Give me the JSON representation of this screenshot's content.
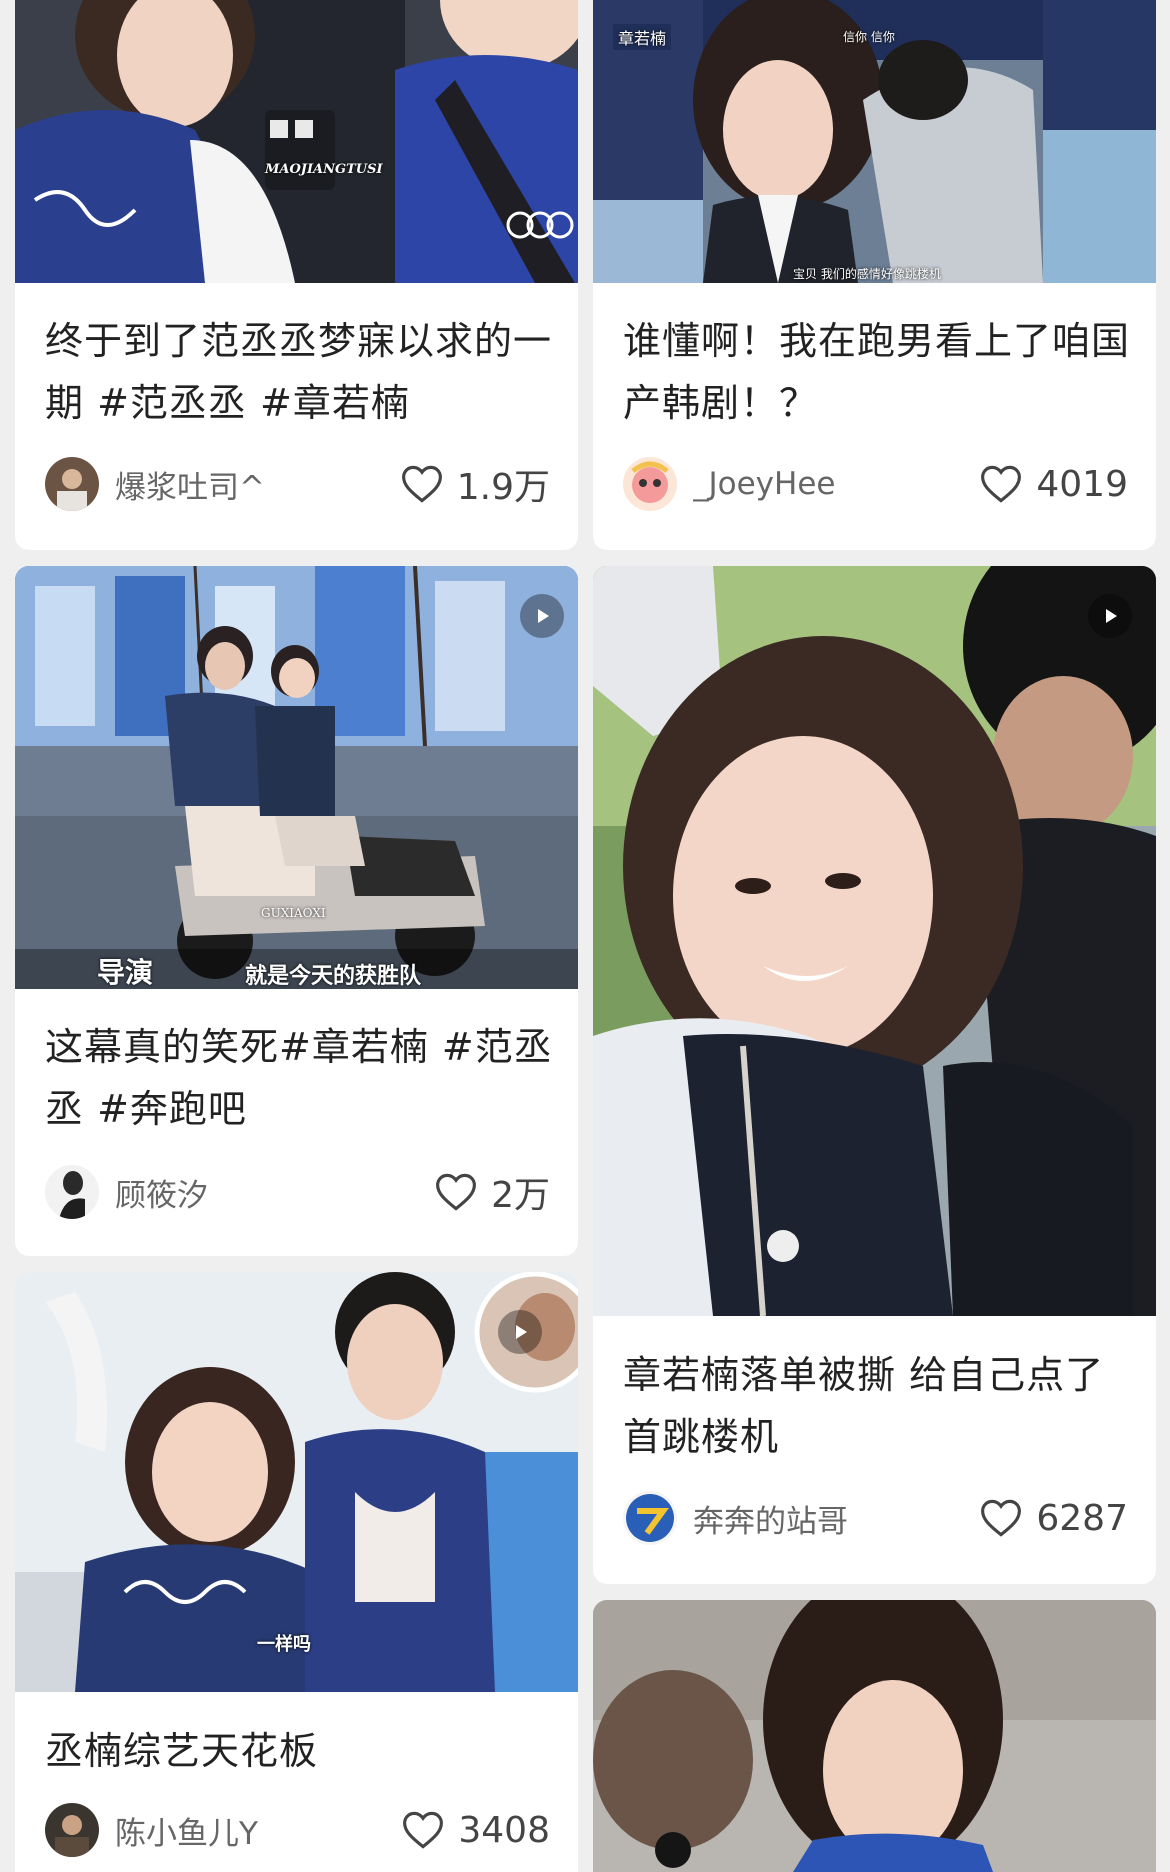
{
  "feed": {
    "cards": [
      {
        "caption": "终于到了范丞丞梦寐以求的一期 #范丞丞 #章若楠",
        "author": "爆浆吐司^",
        "likes": "1.9万",
        "thumb_text": "MAOJIANGTUSI",
        "is_video": false
      },
      {
        "caption": "谁懂啊！我在跑男看上了咱国产韩剧！？",
        "author": "_JoeyHee",
        "likes": "4019",
        "thumb_text_top": "信你 信你",
        "thumb_text_bottom": "宝贝 我们的感情好像跳楼机",
        "thumb_badge": "章若楠",
        "is_video": false
      },
      {
        "caption": "这幕真的笑死#章若楠 #范丞丞 #奔跑吧",
        "author": "顾筱汐",
        "likes": "2万",
        "thumb_subtitle": "就是今天的获胜队",
        "thumb_logo": "导演",
        "thumb_watermark": "GUXIAOXI",
        "is_video": true
      },
      {
        "caption": "章若楠落单被撕 给自己点了首跳楼机",
        "author": "奔奔的站哥",
        "likes": "6287",
        "is_video": true
      },
      {
        "caption": "丞楠综艺天花板",
        "author": "陈小鱼儿Y",
        "likes": "3408",
        "thumb_subtitle": "一样吗",
        "is_video": true
      },
      {
        "caption": "",
        "author": "",
        "likes": "",
        "is_video": false
      }
    ]
  },
  "icons": {
    "like": "heart-outline-icon",
    "video": "play-icon"
  },
  "colors": {
    "background": "#efefef",
    "card": "#ffffff",
    "caption": "#222222",
    "author": "#666666"
  }
}
